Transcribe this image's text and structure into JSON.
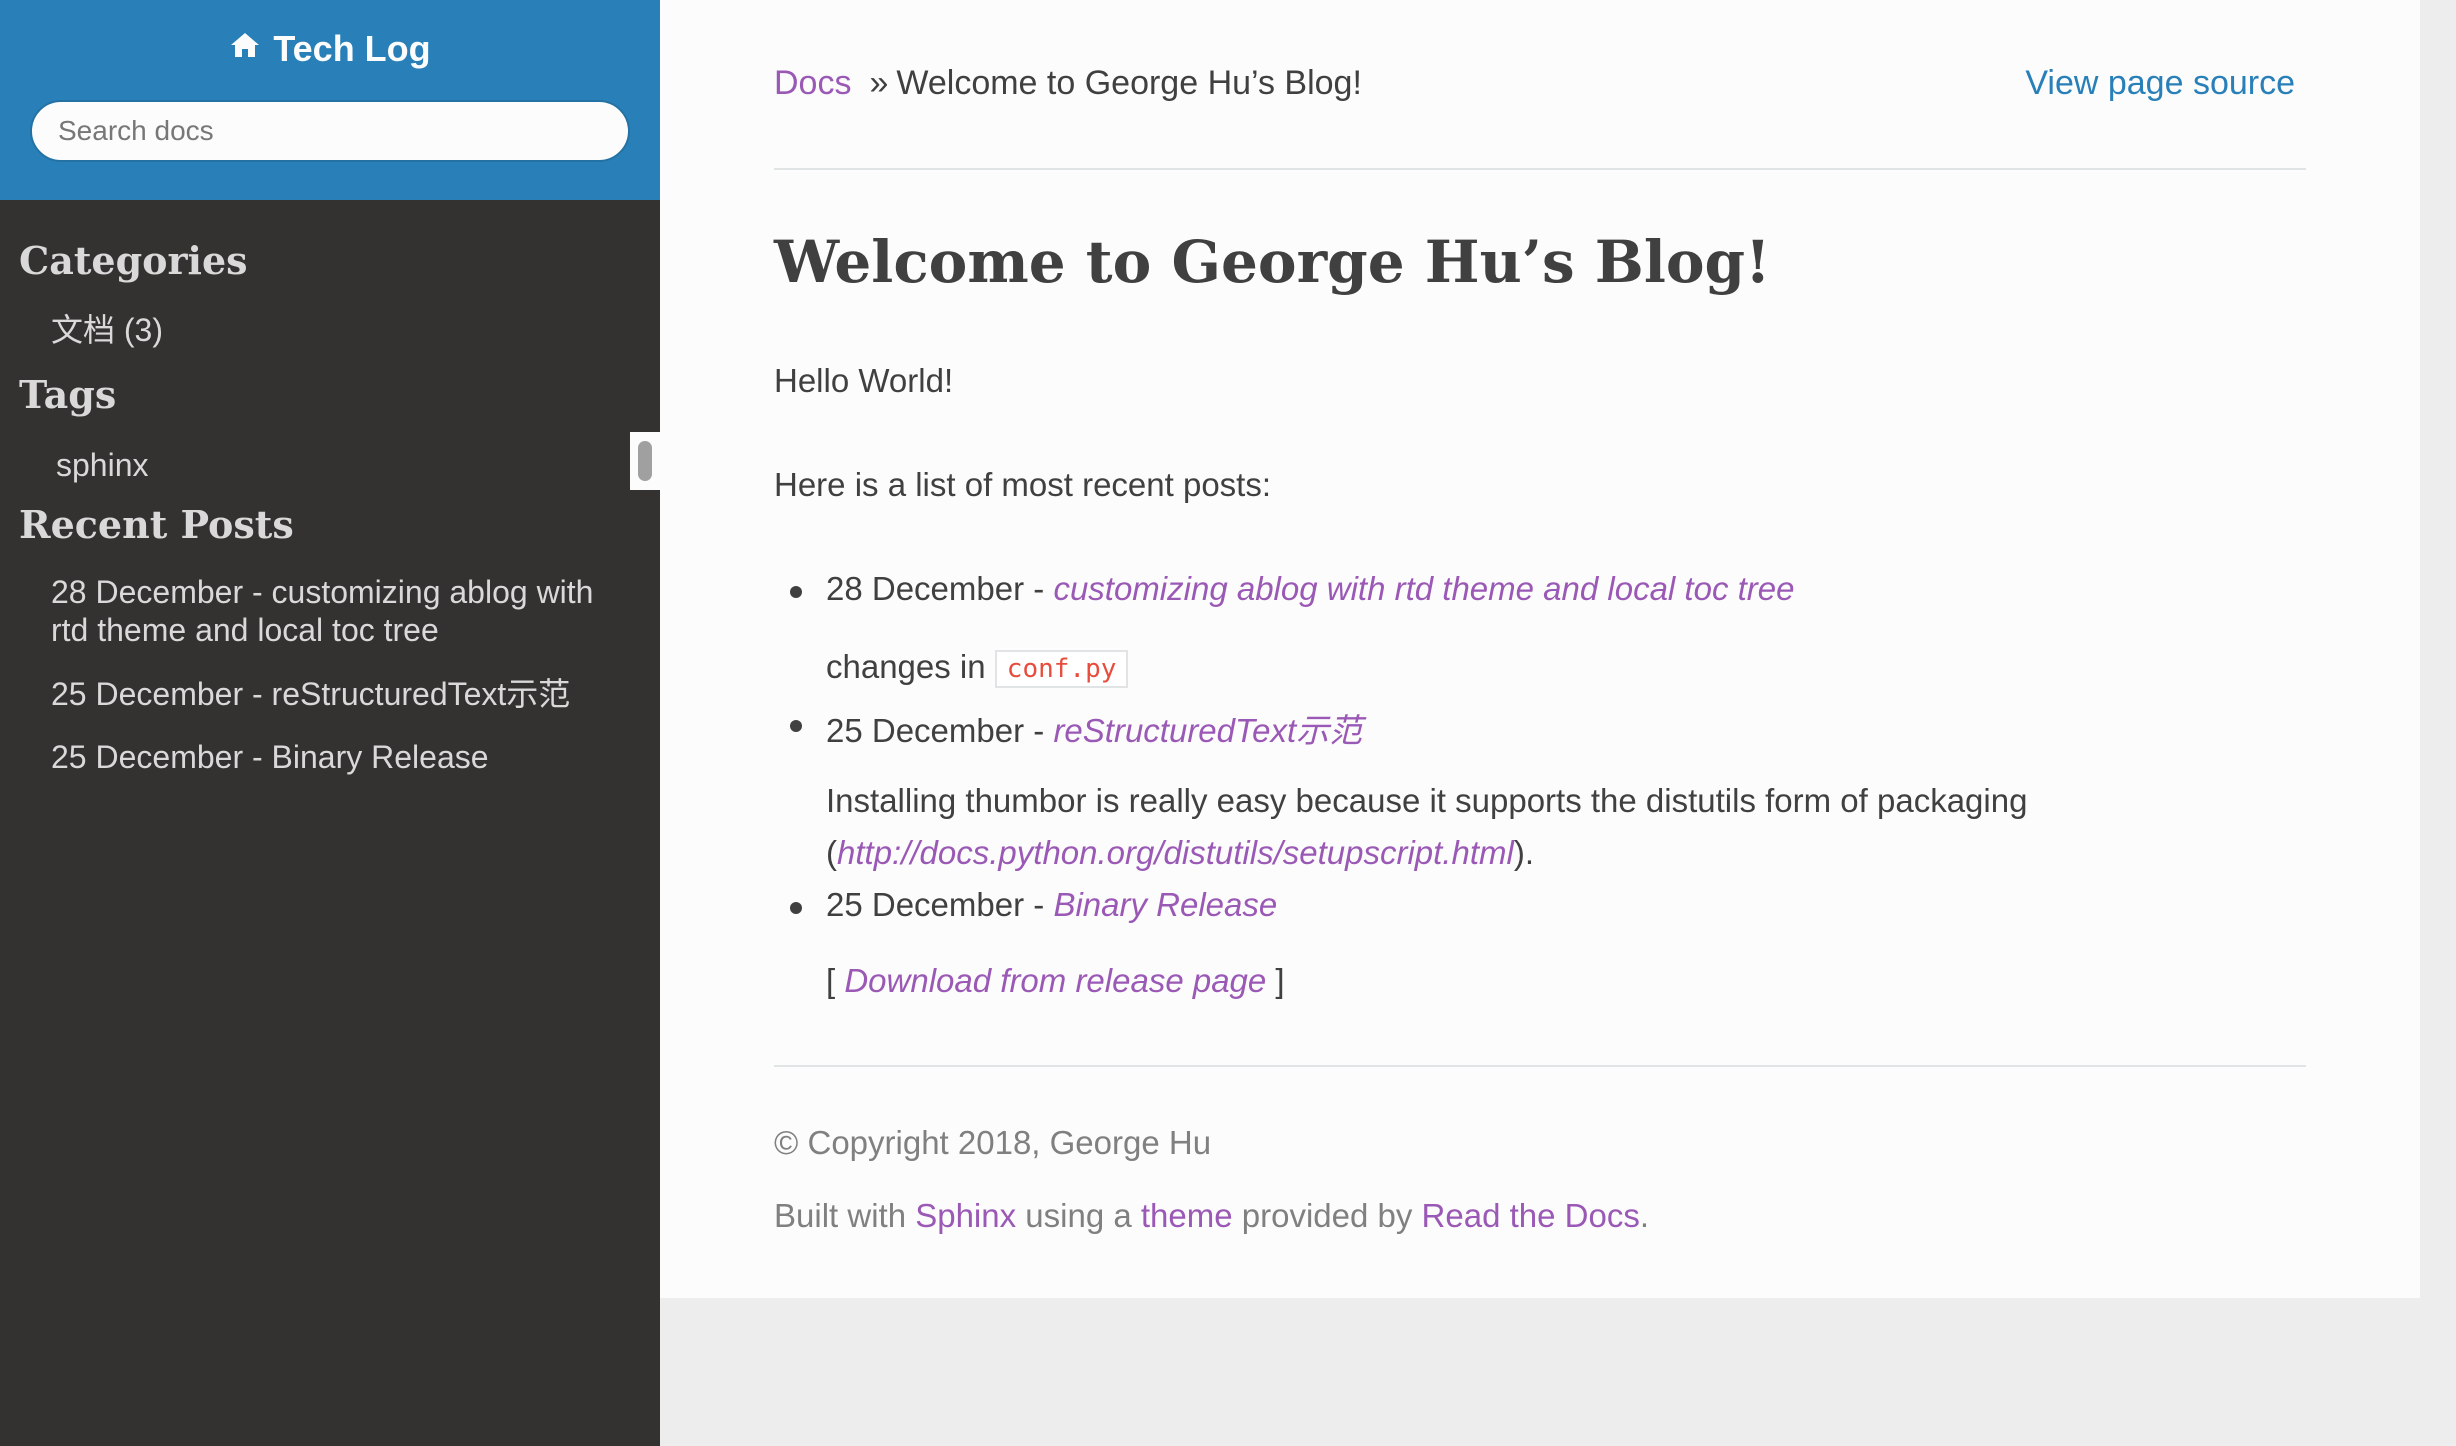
{
  "sidebar": {
    "project_name": "Tech Log",
    "search_placeholder": "Search docs",
    "categories_heading": "Categories",
    "categories": [
      "文档 (3)"
    ],
    "tags_heading": "Tags",
    "tags": [
      "sphinx"
    ],
    "recent_heading": "Recent Posts",
    "recent_posts": [
      "28 December - customizing ablog with rtd theme and local toc tree",
      "25 December - reStructuredText示范",
      "25 December - Binary Release"
    ]
  },
  "breadcrumb": {
    "home_label": "Docs",
    "separator": "»",
    "current": "Welcome to George Hu’s Blog!"
  },
  "view_source_label": "View page source",
  "page": {
    "title": "Welcome to George Hu’s Blog!",
    "intro": "Hello World!",
    "list_intro": "Here is a list of most recent posts:",
    "posts": [
      {
        "date": "28 December - ",
        "link": "customizing ablog with rtd theme and local toc tree",
        "excerpt_prefix": "changes in ",
        "excerpt_code": "conf.py"
      },
      {
        "date": "25 December - ",
        "link": "reStructuredText示范",
        "excerpt_line1": "Installing thumbor is really easy because it supports the distutils form of packaging",
        "excerpt_open": "(",
        "excerpt_link": "http://docs.python.org/distutils/setupscript.html",
        "excerpt_close": ")."
      },
      {
        "date": "25 December - ",
        "link": "Binary Release",
        "excerpt_open": "[ ",
        "excerpt_link": "Download from release page",
        "excerpt_close": " ]"
      }
    ]
  },
  "footer": {
    "copyright": "© Copyright 2018, George Hu",
    "built_prefix": "Built with ",
    "sphinx_label": "Sphinx",
    "using_a": " using a ",
    "theme_label": "theme",
    "provided_by": " provided by ",
    "rtd_label": "Read the Docs",
    "period": "."
  },
  "colors": {
    "sidebar_bg": "#343131",
    "header_blue": "#2980b9",
    "link_purple": "#9b59b6",
    "code_red": "#e74c3c"
  },
  "icons": {
    "project": "home-icon"
  }
}
